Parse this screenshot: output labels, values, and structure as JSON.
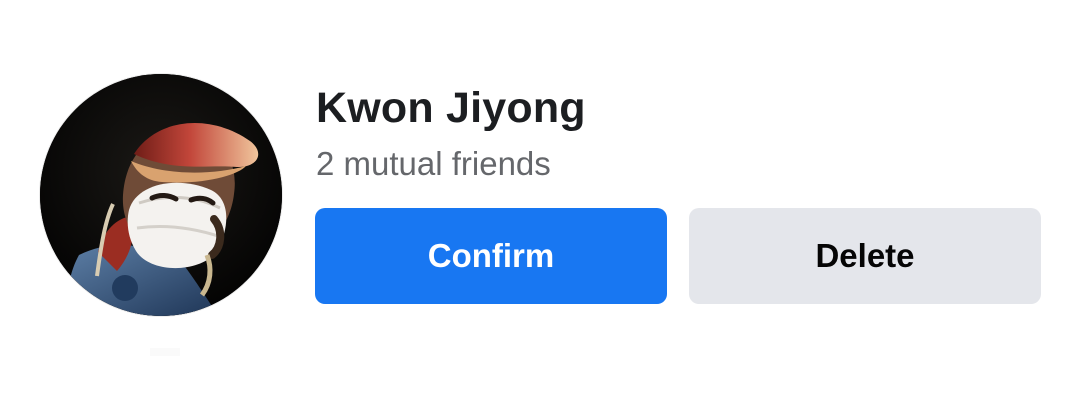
{
  "friend_request": {
    "name": "Kwon Jiyong",
    "mutual_friends": "2 mutual friends",
    "avatar_icon": "profile-photo-icon",
    "buttons": {
      "confirm": "Confirm",
      "delete": "Delete"
    },
    "colors": {
      "confirm_background": "#1877f2",
      "confirm_text": "#ffffff",
      "delete_background": "#e4e6eb",
      "delete_text": "#050505",
      "name_text": "#1c1e21",
      "mutual_text": "#65676b"
    }
  }
}
